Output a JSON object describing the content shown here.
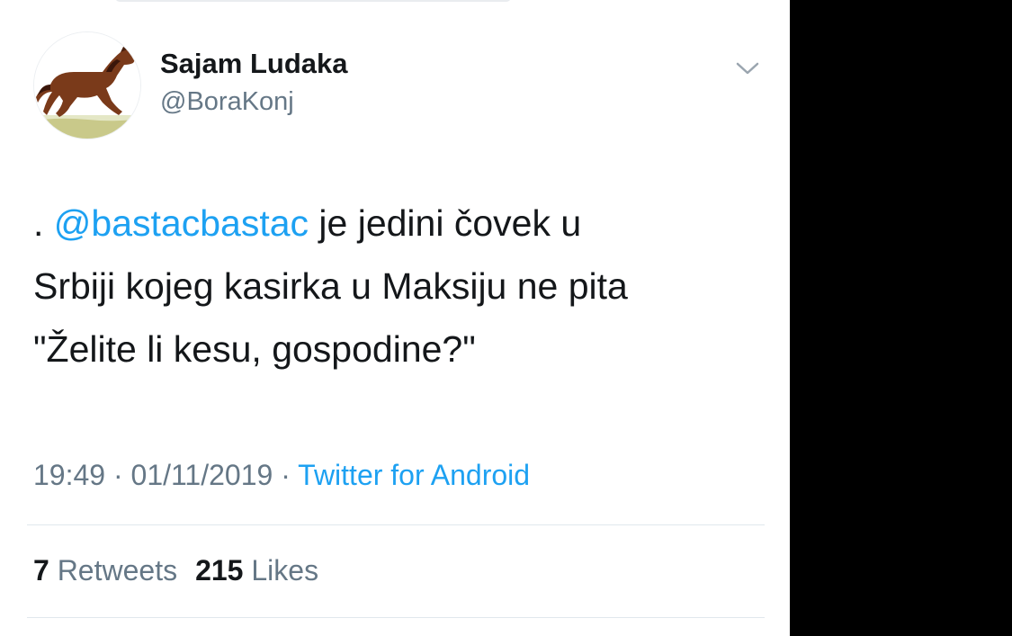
{
  "tweet": {
    "display_name": "Sajam Ludaka",
    "handle": "@BoraKonj",
    "text": {
      "prefix": ". ",
      "mention": "@bastacbastac",
      "line1_rest": " je jedini čovek u",
      "line2": "Srbiji kojeg kasirka u Maksiju ne pita",
      "line3": "\"Želite li kesu, gospodine?\""
    },
    "time": "19:49",
    "separator": " · ",
    "date": "01/11/2019",
    "source": "Twitter for Android",
    "retweets": {
      "count": "7",
      "label": "Retweets"
    },
    "likes": {
      "count": "215",
      "label": "Likes"
    }
  },
  "icons": {
    "avatar": "horse-avatar",
    "menu": "chevron-down-icon"
  },
  "colors": {
    "link": "#1da1f2",
    "secondary_text": "#657786",
    "primary_text": "#14171a",
    "divider": "#e1e8ed",
    "background_right": "#000000"
  }
}
